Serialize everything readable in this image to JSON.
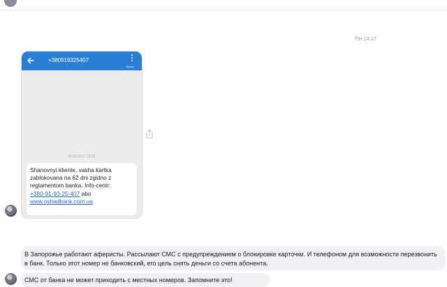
{
  "chat": {
    "timestamp": "ПН 14:17"
  },
  "screenshot": {
    "phone_number": "+380919325407",
    "sim_label": "Simom",
    "sms_date": "06.03.2017 13:03",
    "sms_lines": [
      "Shanovnyi kliente, vasha kartka",
      "zablokovana na 62 dni zgidno z",
      "reglamentom banka. Info-centr:"
    ],
    "sms_phone_link": "+380-91-93-25-407",
    "sms_abo": " abo",
    "sms_site_link": "www.oshadbank.com.ua"
  },
  "messages": [
    {
      "text": "В Запорожье работают аферисты. Рассылают СМС с предупреждением о блокировке карточки. И телефоном для возможности перезвонить в банк. Только этот номер не банковский, его цель снять деньги со счета абонента."
    },
    {
      "text": "СМС от банка не может приходить с местных номеров. Запомните это!"
    }
  ],
  "colors": {
    "header_blue": "#2a7fd4",
    "link_blue": "#2a67c8",
    "bubble_gray": "#eff0f3"
  },
  "icons": {
    "back": "arrow-left-icon",
    "menu": "more-vertical-icon",
    "share": "share-icon"
  }
}
